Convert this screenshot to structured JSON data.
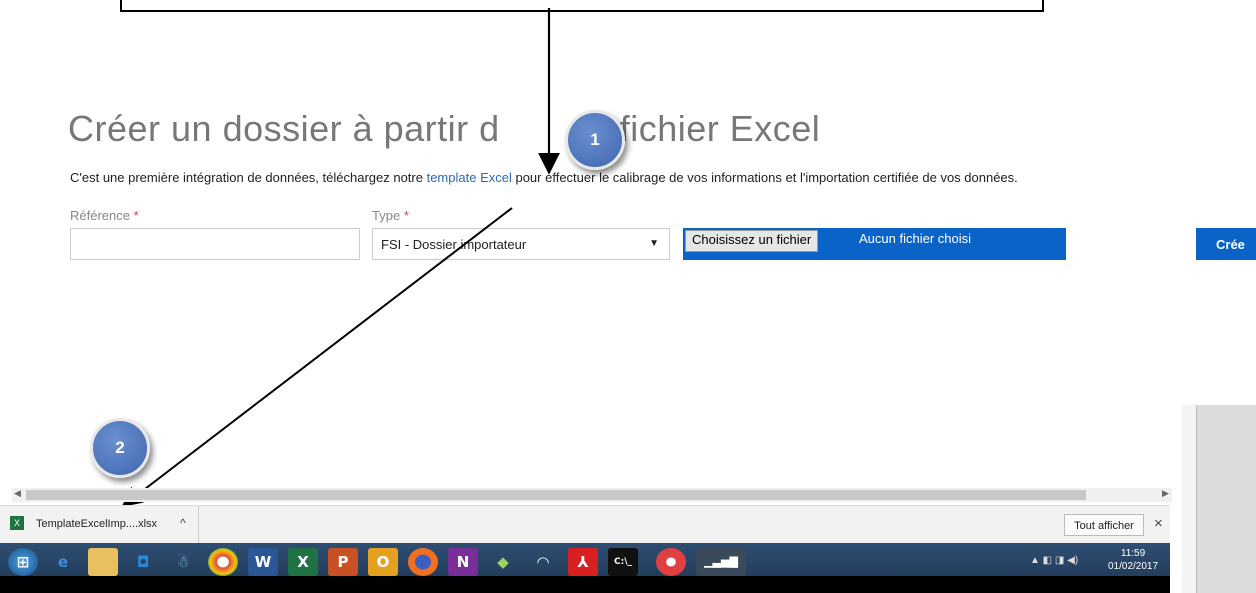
{
  "page": {
    "title": "Créer un dossier à partir d'un fichier Excel",
    "title_visible_left": "Créer un dossier à partir d",
    "title_visible_right": "fichier Excel",
    "intro_before": "C'est une première intégration de données, téléchargez notre ",
    "intro_link": "template Excel",
    "intro_after": " pour effectuer le calibrage de vos informations et l'importation certifiée de vos données."
  },
  "form": {
    "reference_label": "Référence",
    "reference_value": "",
    "type_label": "Type",
    "required_mark": "*",
    "type_value": "FSI - Dossier importateur",
    "file_button_label": "Choisissez un fichier",
    "file_status": "Aucun fichier choisi",
    "create_button_label": "Crée"
  },
  "annotations": {
    "badge_1": "1",
    "badge_2": "2"
  },
  "download_bar": {
    "file_name": "TemplateExcelImp....xlsx",
    "show_all_label": "Tout afficher",
    "close_label": "×"
  },
  "taskbar": {
    "clock_time": "11:59",
    "clock_date": "01/02/2017",
    "icons": [
      "start-orb",
      "ie",
      "explorer",
      "outlook-app",
      "people",
      "chrome",
      "word",
      "excel",
      "powerpoint",
      "outlook",
      "firefox",
      "onenote",
      "explorer-2",
      "wifi",
      "acrobat",
      "cmd",
      "app-red",
      "signal"
    ]
  },
  "colors": {
    "accent_blue": "#0a64c8",
    "link_blue": "#2a6db5",
    "badge_blue": "#4a72bb",
    "required_red": "#e04040"
  }
}
